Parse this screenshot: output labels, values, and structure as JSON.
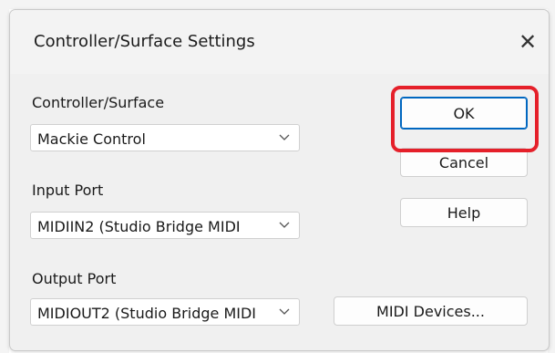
{
  "dialog": {
    "title": "Controller/Surface Settings",
    "close_glyph": "✕"
  },
  "fields": {
    "controller_label": "Controller/Surface",
    "controller_value": "Mackie Control",
    "input_label": "Input Port",
    "input_value": "MIDIIN2 (Studio Bridge MIDI",
    "output_label": "Output Port",
    "output_value": "MIDIOUT2 (Studio Bridge MIDI"
  },
  "buttons": {
    "ok": "OK",
    "cancel": "Cancel",
    "help": "Help",
    "midi_devices": "MIDI Devices..."
  },
  "icons": {
    "close": "close-icon",
    "dropdown": "chevron-down-icon"
  },
  "colors": {
    "highlight": "#e5202a",
    "default_button_border": "#0067c0"
  }
}
